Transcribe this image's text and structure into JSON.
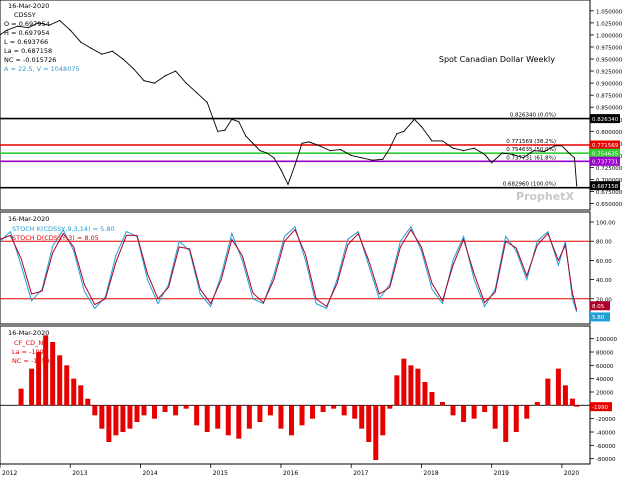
{
  "chart_data": [
    {
      "type": "line",
      "title": "Spot Canadian Dollar Weekly",
      "info": {
        "date": "16-Mar-2020",
        "symbol": "CDSSY",
        "o": "O = 0.697954",
        "h": "H = 0.697954",
        "l": "L = 0.693766",
        "la": "La = 0.687158",
        "nc": "NC = -0.015726",
        "a": "A = 22.5, V = 1048075"
      },
      "watermark": "ProphetX",
      "yticks": [
        0.65,
        0.675,
        0.7,
        0.725,
        0.75,
        0.775,
        0.8,
        0.825,
        0.85,
        0.875,
        0.9,
        0.925,
        0.95,
        0.975,
        1.0,
        1.025,
        1.05
      ],
      "ytick_labels": [
        "0.650000",
        "0.675000",
        "0.700000",
        "0.725000",
        "0.750000",
        "0.775000",
        "0.800000",
        "0.825000",
        "0.850000",
        "0.875000",
        "0.900000",
        "0.925000",
        "0.950000",
        "0.975000",
        "1.000000",
        "1.025000",
        "1.050000"
      ],
      "ylim": [
        0.645,
        1.06
      ],
      "levels": [
        {
          "value": 0.82634,
          "label": "0.826340 (0.0%)",
          "tag": "0.826340",
          "color": "#000000"
        },
        {
          "value": 0.771569,
          "label": "0.771569 (38.2%)",
          "tag": "0.771569",
          "color": "#e60000"
        },
        {
          "value": 0.754635,
          "label": "0.754635 (50.0%)",
          "tag": "0.754635",
          "color": "#33cc33"
        },
        {
          "value": 0.737731,
          "label": "0.737731 (61.8%)",
          "tag": "0.737731",
          "color": "#9900cc"
        },
        {
          "value": 0.68296,
          "label": "0.682960 (100.0%)",
          "tag": "0.687158",
          "color": "#000000"
        }
      ],
      "series": [
        {
          "x": [
            2012.0,
            2012.1,
            2012.25,
            2012.4,
            2012.55,
            2012.7,
            2012.85,
            2013.0,
            2013.15,
            2013.3,
            2013.45,
            2013.6,
            2013.75,
            2013.9,
            2014.05,
            2014.2,
            2014.35,
            2014.5,
            2014.65,
            2014.8,
            2014.95,
            2015.1,
            2015.2,
            2015.3,
            2015.4,
            2015.5,
            2015.6,
            2015.7,
            2015.8,
            2015.9,
            2016.0,
            2016.1,
            2016.2,
            2016.3,
            2016.4,
            2016.55,
            2016.7,
            2016.85,
            2017.0,
            2017.15,
            2017.3,
            2017.45,
            2017.55,
            2017.65,
            2017.75,
            2017.9,
            2018.0,
            2018.15,
            2018.3,
            2018.45,
            2018.6,
            2018.75,
            2018.9,
            2019.0,
            2019.15,
            2019.3,
            2019.45,
            2019.6,
            2019.75,
            2019.9,
            2020.0,
            2020.1,
            2020.18,
            2020.21
          ],
          "values": [
            1.0,
            1.01,
            1.018,
            1.015,
            1.025,
            1.02,
            1.03,
            1.01,
            0.985,
            0.972,
            0.96,
            0.966,
            0.95,
            0.93,
            0.905,
            0.9,
            0.915,
            0.925,
            0.9,
            0.88,
            0.86,
            0.8,
            0.802,
            0.825,
            0.82,
            0.79,
            0.775,
            0.76,
            0.755,
            0.745,
            0.72,
            0.69,
            0.73,
            0.775,
            0.778,
            0.77,
            0.76,
            0.762,
            0.75,
            0.745,
            0.74,
            0.742,
            0.765,
            0.795,
            0.8,
            0.825,
            0.81,
            0.78,
            0.78,
            0.765,
            0.76,
            0.765,
            0.752,
            0.735,
            0.755,
            0.752,
            0.745,
            0.76,
            0.758,
            0.77,
            0.77,
            0.755,
            0.745,
            0.687
          ]
        }
      ],
      "xticks": [
        "2012",
        "2013",
        "2014",
        "2015",
        "2016",
        "2017",
        "2018",
        "2019",
        "2020"
      ]
    },
    {
      "type": "line",
      "info": {
        "date": "16-Mar-2020",
        "stoch_k": "STOCH K(CDSSY,9,3,14) = 5.80",
        "stoch_d": "STOCH D(CDSSY,3) = 8.05"
      },
      "ylim": [
        0,
        100
      ],
      "yticks": [
        20,
        40,
        60,
        80,
        100
      ],
      "ytick_labels": [
        "20.00",
        "40.00",
        "60.00",
        "80.00",
        "100.00"
      ],
      "hlines": [
        80,
        20
      ],
      "tags": [
        "8.05",
        "5.80"
      ],
      "series": [
        {
          "name": "STOCH K",
          "x": [
            2012.0,
            2012.15,
            2012.3,
            2012.45,
            2012.6,
            2012.75,
            2012.9,
            2013.05,
            2013.2,
            2013.35,
            2013.5,
            2013.65,
            2013.8,
            2013.95,
            2014.1,
            2014.25,
            2014.4,
            2014.55,
            2014.7,
            2014.85,
            2015.0,
            2015.15,
            2015.3,
            2015.45,
            2015.6,
            2015.75,
            2015.9,
            2016.05,
            2016.2,
            2016.35,
            2016.5,
            2016.65,
            2016.8,
            2016.95,
            2017.1,
            2017.25,
            2017.4,
            2017.55,
            2017.7,
            2017.85,
            2018.0,
            2018.15,
            2018.3,
            2018.45,
            2018.6,
            2018.75,
            2018.9,
            2019.05,
            2019.2,
            2019.35,
            2019.5,
            2019.65,
            2019.8,
            2019.95,
            2020.05,
            2020.15,
            2020.21
          ],
          "values": [
            80,
            90,
            55,
            18,
            30,
            75,
            92,
            70,
            28,
            10,
            22,
            65,
            90,
            85,
            40,
            15,
            35,
            80,
            70,
            25,
            12,
            45,
            88,
            60,
            20,
            15,
            45,
            85,
            95,
            60,
            15,
            10,
            40,
            82,
            90,
            55,
            20,
            35,
            80,
            95,
            70,
            30,
            15,
            60,
            85,
            40,
            12,
            30,
            85,
            70,
            40,
            80,
            90,
            55,
            80,
            20,
            6
          ]
        },
        {
          "name": "STOCH D",
          "x": [
            2012.0,
            2012.15,
            2012.3,
            2012.45,
            2012.6,
            2012.75,
            2012.9,
            2013.05,
            2013.2,
            2013.35,
            2013.5,
            2013.65,
            2013.8,
            2013.95,
            2014.1,
            2014.25,
            2014.4,
            2014.55,
            2014.7,
            2014.85,
            2015.0,
            2015.15,
            2015.3,
            2015.45,
            2015.6,
            2015.75,
            2015.9,
            2016.05,
            2016.2,
            2016.35,
            2016.5,
            2016.65,
            2016.8,
            2016.95,
            2017.1,
            2017.25,
            2017.4,
            2017.55,
            2017.7,
            2017.85,
            2018.0,
            2018.15,
            2018.3,
            2018.45,
            2018.6,
            2018.75,
            2018.9,
            2019.05,
            2019.2,
            2019.35,
            2019.5,
            2019.65,
            2019.8,
            2019.95,
            2020.05,
            2020.15,
            2020.21
          ],
          "values": [
            82,
            86,
            62,
            25,
            28,
            68,
            88,
            74,
            35,
            14,
            20,
            58,
            86,
            86,
            46,
            20,
            32,
            74,
            72,
            30,
            15,
            40,
            82,
            65,
            26,
            16,
            40,
            80,
            92,
            66,
            20,
            12,
            36,
            76,
            88,
            60,
            25,
            32,
            74,
            92,
            74,
            36,
            18,
            55,
            82,
            46,
            16,
            27,
            80,
            73,
            44,
            76,
            88,
            60,
            76,
            26,
            8
          ]
        }
      ]
    },
    {
      "type": "bar",
      "info": {
        "date": "16-Mar-2020",
        "symbol": "CF_CD_NN",
        "la": "La = -1990",
        "nc": "NC = -12591"
      },
      "ylim": [
        -85000,
        110000
      ],
      "yticks": [
        -80000,
        -60000,
        -40000,
        -20000,
        0,
        20000,
        40000,
        60000,
        80000,
        100000
      ],
      "ytick_labels": [
        "-80000",
        "-60000",
        "-40000",
        "-20000",
        "0",
        "20000",
        "40000",
        "60000",
        "80000",
        "100000"
      ],
      "tag": "-1990",
      "series": [
        {
          "x": [
            2012.3,
            2012.45,
            2012.55,
            2012.65,
            2012.75,
            2012.85,
            2012.95,
            2013.05,
            2013.15,
            2013.25,
            2013.35,
            2013.45,
            2013.55,
            2013.65,
            2013.75,
            2013.85,
            2013.95,
            2014.05,
            2014.2,
            2014.35,
            2014.5,
            2014.65,
            2014.8,
            2014.95,
            2015.1,
            2015.25,
            2015.4,
            2015.55,
            2015.7,
            2015.85,
            2016.0,
            2016.15,
            2016.3,
            2016.45,
            2016.6,
            2016.75,
            2016.9,
            2017.05,
            2017.15,
            2017.25,
            2017.35,
            2017.45,
            2017.55,
            2017.65,
            2017.75,
            2017.85,
            2017.95,
            2018.05,
            2018.15,
            2018.3,
            2018.45,
            2018.6,
            2018.75,
            2018.9,
            2019.05,
            2019.2,
            2019.35,
            2019.5,
            2019.65,
            2019.8,
            2019.95,
            2020.05,
            2020.15,
            2020.21
          ],
          "values": [
            25000,
            55000,
            80000,
            105000,
            95000,
            75000,
            60000,
            40000,
            30000,
            10000,
            -15000,
            -35000,
            -55000,
            -45000,
            -40000,
            -35000,
            -25000,
            -15000,
            -20000,
            -10000,
            -15000,
            -5000,
            -30000,
            -40000,
            -35000,
            -45000,
            -50000,
            -35000,
            -25000,
            -15000,
            -35000,
            -45000,
            -30000,
            -20000,
            -10000,
            -5000,
            -15000,
            -20000,
            -35000,
            -55000,
            -82000,
            -45000,
            -5000,
            45000,
            70000,
            60000,
            55000,
            35000,
            20000,
            5000,
            -15000,
            -25000,
            -20000,
            -10000,
            -35000,
            -55000,
            -40000,
            -20000,
            5000,
            40000,
            55000,
            30000,
            10000,
            -1990
          ]
        }
      ],
      "xticks": [
        "2012",
        "2013",
        "2014",
        "2015",
        "2016",
        "2017",
        "2018",
        "2019",
        "2020"
      ]
    }
  ]
}
